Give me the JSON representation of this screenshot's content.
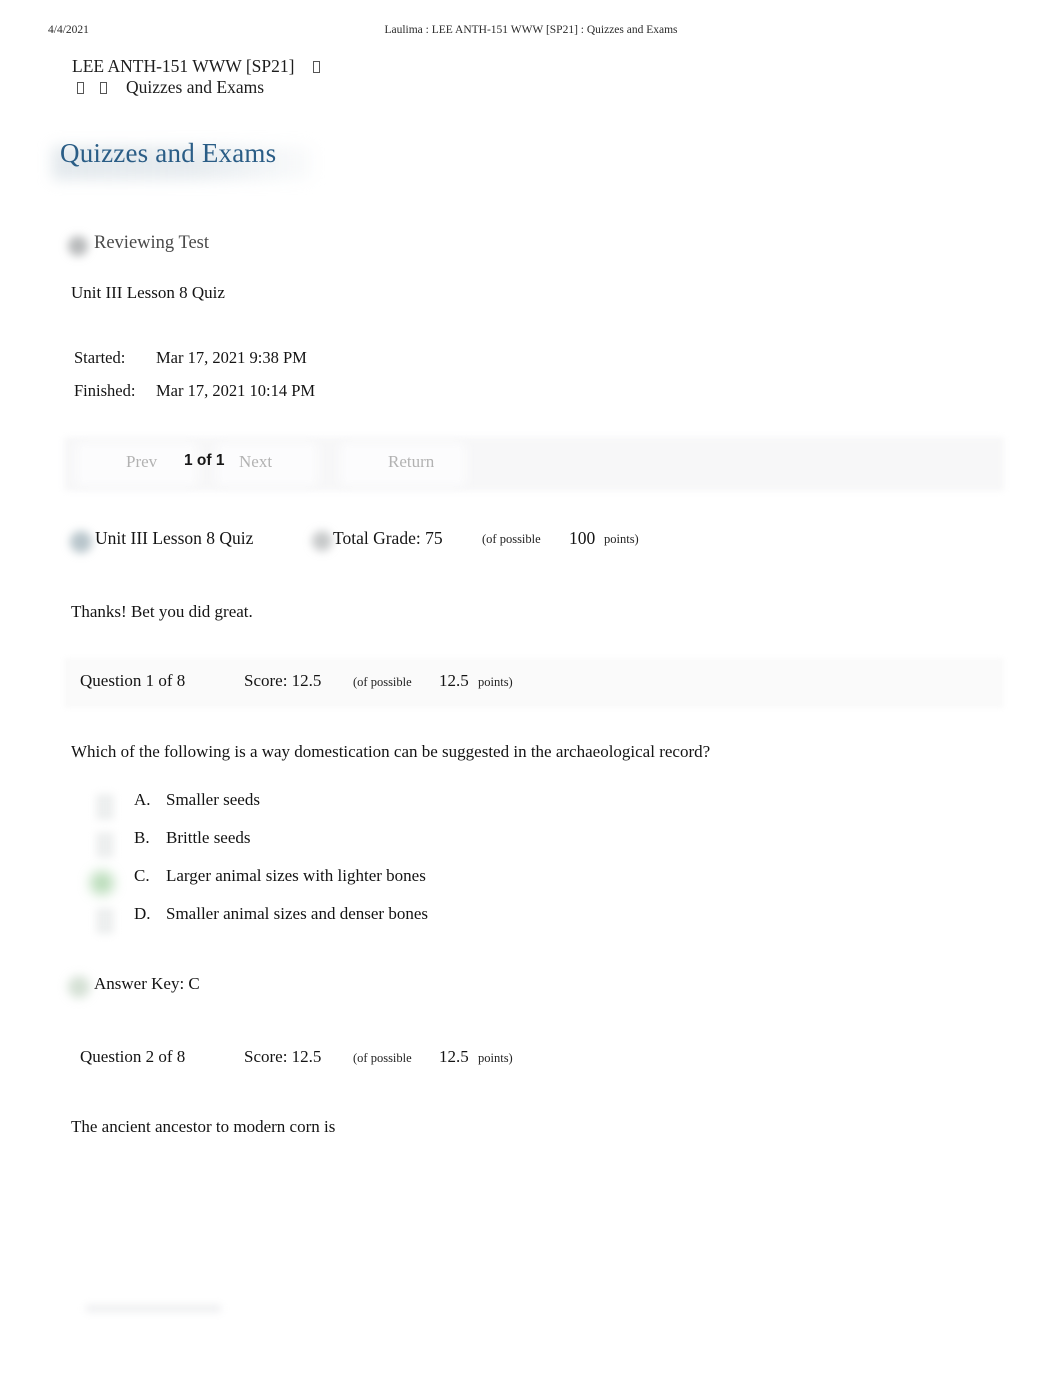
{
  "print_header": {
    "date": "4/4/2021",
    "title": "Laulima : LEE ANTH-151 WWW [SP21] : Quizzes and Exams"
  },
  "breadcrumb": {
    "site": "LEE ANTH-151 WWW [SP21]",
    "tool": "Quizzes and Exams"
  },
  "page": {
    "title": "Quizzes and Exams",
    "accent_color": "#2a5d86"
  },
  "assessment": {
    "status_label": "Reviewing Test",
    "name": "Unit III Lesson 8 Quiz",
    "started_label": "Started:",
    "started_value": "Mar 17, 2021 9:38 PM",
    "finished_label": "Finished:",
    "finished_value": "Mar 17, 2021 10:14 PM"
  },
  "nav": {
    "prev_label": "Prev",
    "pager_label": "1 of 1",
    "next_label": "Next",
    "return_label": "Return"
  },
  "grade": {
    "quiz_name": "Unit III Lesson 8 Quiz",
    "total_label": "Total Grade: 75",
    "of_possible_label": "(of possible",
    "possible_points": "100",
    "points_label": "points)"
  },
  "feedback": {
    "text": "Thanks! Bet you did great."
  },
  "questions": [
    {
      "header": {
        "label": "Question 1 of 8",
        "score_label": "Score: 12.5",
        "of_possible_label": "(of possible",
        "possible_points": "12.5",
        "points_label": "points)"
      },
      "text": "Which of the following is a way domestication can be suggested in the archaeological record?",
      "options": [
        {
          "letter": "A.",
          "text": "Smaller seeds",
          "selected": false
        },
        {
          "letter": "B.",
          "text": "Brittle seeds",
          "selected": false
        },
        {
          "letter": "C.",
          "text": "Larger animal sizes with lighter bones",
          "selected": true
        },
        {
          "letter": "D.",
          "text": "Smaller animal sizes and denser bones",
          "selected": false
        }
      ],
      "answer_key": "Answer Key: C"
    },
    {
      "header": {
        "label": "Question 2 of 8",
        "score_label": "Score: 12.5",
        "of_possible_label": "(of possible",
        "possible_points": "12.5",
        "points_label": "points)"
      },
      "text": "The ancient ancestor to modern corn is"
    }
  ]
}
